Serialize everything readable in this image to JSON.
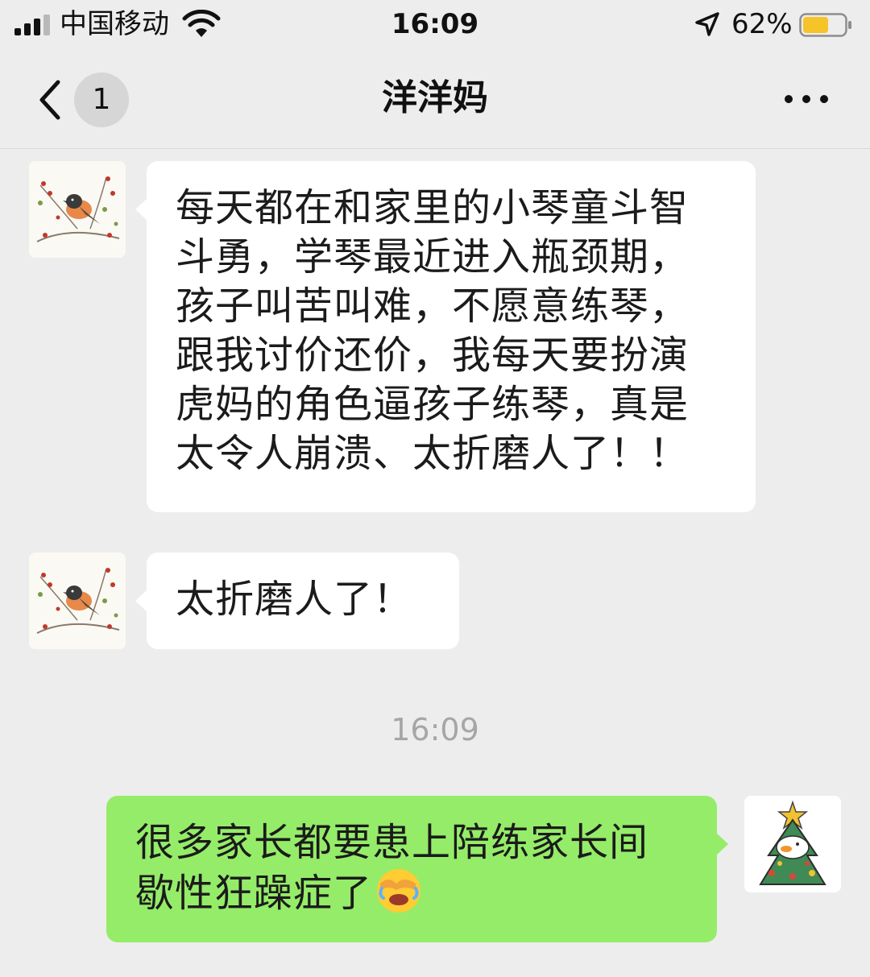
{
  "status_bar": {
    "carrier": "中国移动",
    "time": "16:09",
    "battery_percent": "62%",
    "battery_level": 0.62,
    "icons": [
      "signal-icon",
      "wifi-icon",
      "location-arrow-icon",
      "battery-icon"
    ]
  },
  "nav": {
    "unread_count": "1",
    "title": "洋洋妈",
    "icons": [
      "back-chevron-icon",
      "more-dots-icon"
    ]
  },
  "messages": [
    {
      "side": "left",
      "sender_avatar": "bird-avatar",
      "text": "每天都在和家里的小琴童斗智\n斗勇，学琴最近进入瓶颈期，\n孩子叫苦叫难，不愿意练琴，\n跟我讨价还价，我每天要扮演\n虎妈的角色逼孩子练琴，真是\n太令人崩溃、太折磨人了！！"
    },
    {
      "side": "left",
      "sender_avatar": "bird-avatar",
      "text": "太折磨人了！"
    },
    {
      "side": "right",
      "sender_avatar": "christmas-tree-avatar",
      "text": "很多家长都要患上陪练家长间\n歇性狂躁症了",
      "trailing_emoji": "facepalm-laughing-emoji"
    }
  ],
  "time_divider": "16:09",
  "colors": {
    "background": "#ededed",
    "incoming_bubble": "#ffffff",
    "outgoing_bubble": "#95ec69",
    "timestamp": "#a6a6a6"
  }
}
